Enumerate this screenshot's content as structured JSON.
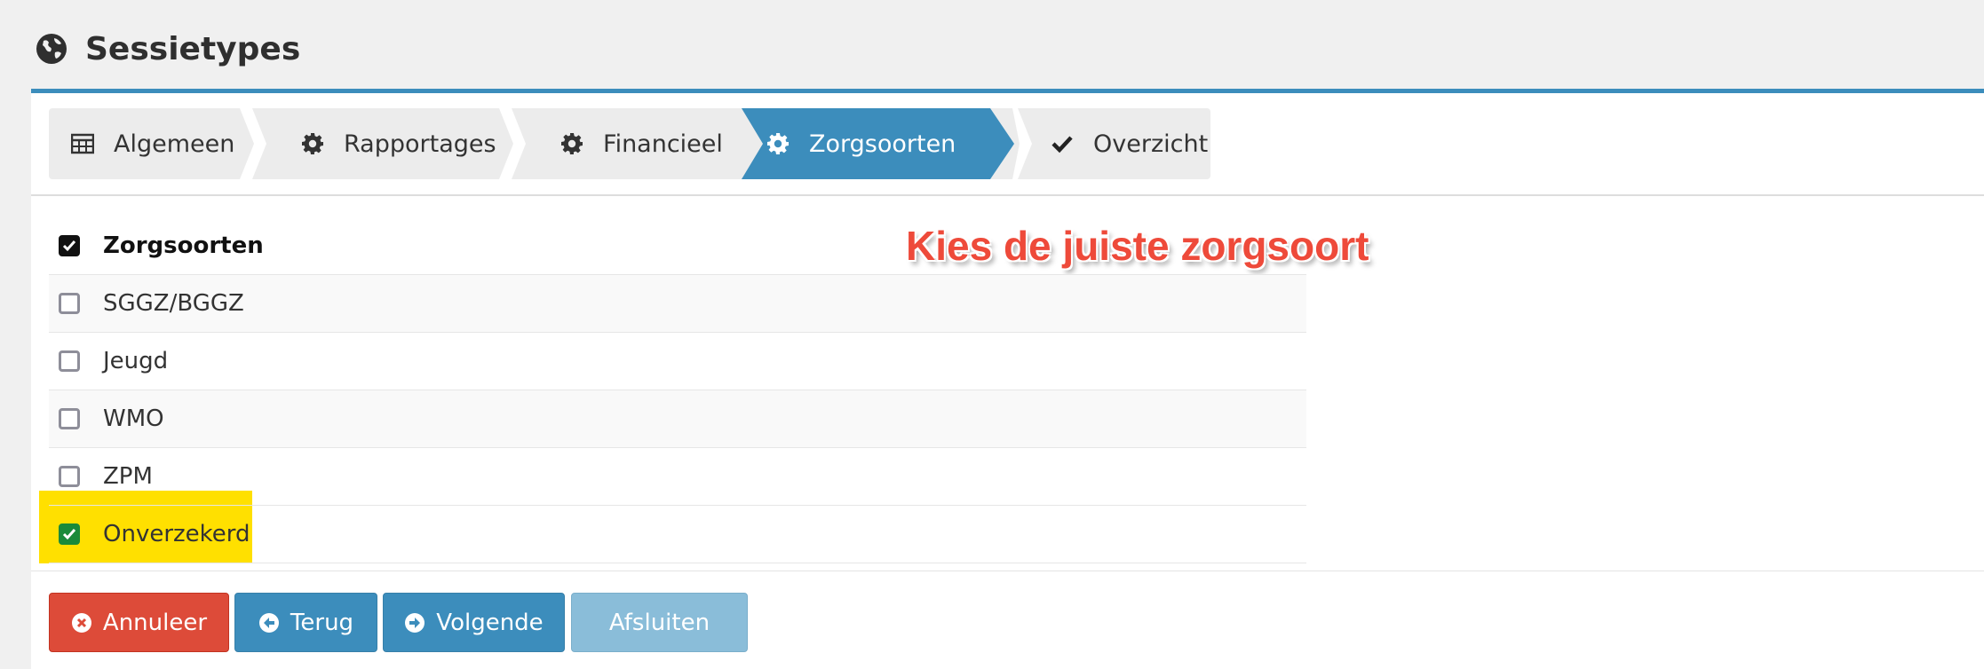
{
  "page": {
    "title": "Sessietypes",
    "icon": "globe-icon"
  },
  "wizard": {
    "steps": [
      {
        "label": "Algemeen",
        "icon": "table-icon",
        "active": false
      },
      {
        "label": "Rapportages",
        "icon": "gear-icon",
        "active": false
      },
      {
        "label": "Financieel",
        "icon": "gear-icon",
        "active": false
      },
      {
        "label": "Zorgsoorten",
        "icon": "gear-icon",
        "active": true
      },
      {
        "label": "Overzicht",
        "icon": "check-icon",
        "active": false
      }
    ]
  },
  "list": {
    "header": {
      "label": "Zorgsoorten",
      "checked": true
    },
    "items": [
      {
        "label": "SGGZ/BGGZ",
        "checked": false
      },
      {
        "label": "Jeugd",
        "checked": false
      },
      {
        "label": "WMO",
        "checked": false
      },
      {
        "label": "ZPM",
        "checked": false
      },
      {
        "label": "Onverzekerd",
        "checked": true,
        "highlighted": true
      }
    ]
  },
  "annotation": {
    "text": "Kies de juiste zorgsoort"
  },
  "footer": {
    "cancel_label": "Annuleer",
    "back_label": "Terug",
    "next_label": "Volgende",
    "finish_label": "Afsluiten"
  },
  "colors": {
    "primary": "#3c8dbc",
    "danger": "#dd4b39",
    "disabled": "#8abdd9",
    "highlight": "#ffe000",
    "annotation": "#ee4a3a",
    "check_green": "#1a8a3a"
  }
}
